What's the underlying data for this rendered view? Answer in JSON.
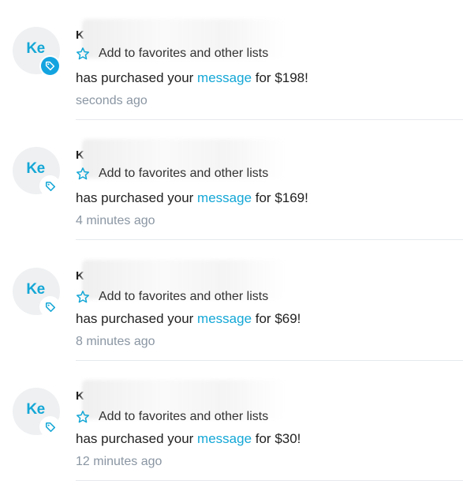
{
  "notifications": [
    {
      "avatar_initials": "Ke",
      "name_visible": "K",
      "favorites_label": "Add to favorites and other lists",
      "text_before": "has purchased your ",
      "link_text": "message",
      "text_after": " for $198!",
      "time": "seconds ago",
      "badge_active": true
    },
    {
      "avatar_initials": "Ke",
      "name_visible": "K",
      "favorites_label": "Add to favorites and other lists",
      "text_before": "has purchased your ",
      "link_text": "message",
      "text_after": " for $169!",
      "time": "4 minutes ago",
      "badge_active": false
    },
    {
      "avatar_initials": "Ke",
      "name_visible": "K",
      "favorites_label": "Add to favorites and other lists",
      "text_before": "has purchased your ",
      "link_text": "message",
      "text_after": " for $69!",
      "time": "8 minutes ago",
      "badge_active": false
    },
    {
      "avatar_initials": "Ke",
      "name_visible": "K",
      "favorites_label": "Add to favorites and other lists",
      "text_before": "has purchased your ",
      "link_text": "message",
      "text_after": " for $30!",
      "time": "12 minutes ago",
      "badge_active": false
    }
  ],
  "icons": {
    "favorite": "star-outline-icon",
    "badge": "price-tag-icon"
  },
  "colors": {
    "accent": "#14a7d6",
    "badge_active": "#13a4e0",
    "muted": "#8a96a3",
    "avatar_bg": "#eef0f2"
  }
}
